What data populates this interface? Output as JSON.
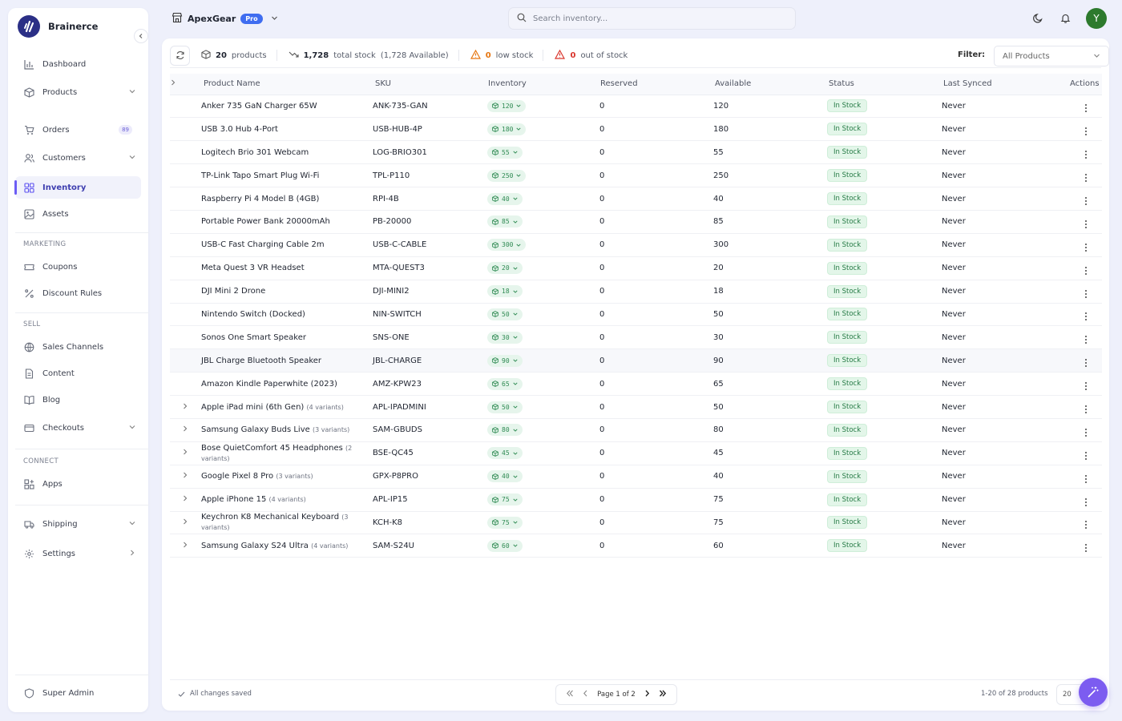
{
  "brand": {
    "name": "Brainerce"
  },
  "sidebar": {
    "items": [
      {
        "label": "Dashboard"
      },
      {
        "label": "Products"
      },
      {
        "label": "Orders",
        "badge": "89"
      },
      {
        "label": "Customers"
      },
      {
        "label": "Inventory",
        "active": true
      },
      {
        "label": "Assets"
      },
      {
        "label": "Coupons"
      },
      {
        "label": "Discount Rules"
      },
      {
        "label": "Sales Channels"
      },
      {
        "label": "Content"
      },
      {
        "label": "Blog"
      },
      {
        "label": "Checkouts"
      },
      {
        "label": "Apps"
      },
      {
        "label": "Shipping"
      },
      {
        "label": "Settings"
      }
    ],
    "sections": {
      "marketing": "MARKETING",
      "sell": "SELL",
      "connect": "CONNECT"
    },
    "footer_label": "Super Admin"
  },
  "topbar": {
    "store_name": "ApexGear",
    "plan_badge": "Pro",
    "search_placeholder": "Search inventory...",
    "avatar_initial": "Y"
  },
  "stats": {
    "products_count": "20",
    "products_label": "products",
    "total_stock": "1,728",
    "total_stock_label": "total stock",
    "available_note": "(1,728 Available)",
    "low_stock_count": "0",
    "low_stock_label": "low stock",
    "out_of_stock_count": "0",
    "out_of_stock_label": "out of stock"
  },
  "filter": {
    "label": "Filter:",
    "value": "All Products"
  },
  "table": {
    "headers": {
      "name": "Product Name",
      "sku": "SKU",
      "inventory": "Inventory",
      "reserved": "Reserved",
      "available": "Available",
      "status": "Status",
      "synced": "Last Synced",
      "actions": "Actions"
    },
    "rows": [
      {
        "name": "Anker 735 GaN Charger 65W",
        "variants": "",
        "sku": "ANK-735-GAN",
        "inventory": "120",
        "reserved": "0",
        "available": "120",
        "status": "In Stock",
        "synced": "Never"
      },
      {
        "name": "USB 3.0 Hub 4-Port",
        "variants": "",
        "sku": "USB-HUB-4P",
        "inventory": "180",
        "reserved": "0",
        "available": "180",
        "status": "In Stock",
        "synced": "Never"
      },
      {
        "name": "Logitech Brio 301 Webcam",
        "variants": "",
        "sku": "LOG-BRIO301",
        "inventory": "55",
        "reserved": "0",
        "available": "55",
        "status": "In Stock",
        "synced": "Never"
      },
      {
        "name": "TP-Link Tapo Smart Plug Wi-Fi",
        "variants": "",
        "sku": "TPL-P110",
        "inventory": "250",
        "reserved": "0",
        "available": "250",
        "status": "In Stock",
        "synced": "Never"
      },
      {
        "name": "Raspberry Pi 4 Model B (4GB)",
        "variants": "",
        "sku": "RPI-4B",
        "inventory": "40",
        "reserved": "0",
        "available": "40",
        "status": "In Stock",
        "synced": "Never"
      },
      {
        "name": "Portable Power Bank 20000mAh",
        "variants": "",
        "sku": "PB-20000",
        "inventory": "85",
        "reserved": "0",
        "available": "85",
        "status": "In Stock",
        "synced": "Never"
      },
      {
        "name": "USB-C Fast Charging Cable 2m",
        "variants": "",
        "sku": "USB-C-CABLE",
        "inventory": "300",
        "reserved": "0",
        "available": "300",
        "status": "In Stock",
        "synced": "Never"
      },
      {
        "name": "Meta Quest 3 VR Headset",
        "variants": "",
        "sku": "MTA-QUEST3",
        "inventory": "20",
        "reserved": "0",
        "available": "20",
        "status": "In Stock",
        "synced": "Never"
      },
      {
        "name": "DJI Mini 2 Drone",
        "variants": "",
        "sku": "DJI-MINI2",
        "inventory": "18",
        "reserved": "0",
        "available": "18",
        "status": "In Stock",
        "synced": "Never"
      },
      {
        "name": "Nintendo Switch (Docked)",
        "variants": "",
        "sku": "NIN-SWITCH",
        "inventory": "50",
        "reserved": "0",
        "available": "50",
        "status": "In Stock",
        "synced": "Never"
      },
      {
        "name": "Sonos One Smart Speaker",
        "variants": "",
        "sku": "SNS-ONE",
        "inventory": "30",
        "reserved": "0",
        "available": "30",
        "status": "In Stock",
        "synced": "Never"
      },
      {
        "name": "JBL Charge Bluetooth Speaker",
        "variants": "",
        "sku": "JBL-CHARGE",
        "inventory": "90",
        "reserved": "0",
        "available": "90",
        "status": "In Stock",
        "synced": "Never"
      },
      {
        "name": "Amazon Kindle Paperwhite (2023)",
        "variants": "",
        "sku": "AMZ-KPW23",
        "inventory": "65",
        "reserved": "0",
        "available": "65",
        "status": "In Stock",
        "synced": "Never"
      },
      {
        "name": "Apple iPad mini (6th Gen)",
        "variants": "(4 variants)",
        "sku": "APL-IPADMINI",
        "inventory": "50",
        "reserved": "0",
        "available": "50",
        "status": "In Stock",
        "synced": "Never"
      },
      {
        "name": "Samsung Galaxy Buds Live",
        "variants": "(3 variants)",
        "sku": "SAM-GBUDS",
        "inventory": "80",
        "reserved": "0",
        "available": "80",
        "status": "In Stock",
        "synced": "Never"
      },
      {
        "name": "Bose QuietComfort 45 Headphones",
        "variants": "(2 variants)",
        "sku": "BSE-QC45",
        "inventory": "45",
        "reserved": "0",
        "available": "45",
        "status": "In Stock",
        "synced": "Never"
      },
      {
        "name": "Google Pixel 8 Pro",
        "variants": "(3 variants)",
        "sku": "GPX-P8PRO",
        "inventory": "40",
        "reserved": "0",
        "available": "40",
        "status": "In Stock",
        "synced": "Never"
      },
      {
        "name": "Apple iPhone 15",
        "variants": "(4 variants)",
        "sku": "APL-IP15",
        "inventory": "75",
        "reserved": "0",
        "available": "75",
        "status": "In Stock",
        "synced": "Never"
      },
      {
        "name": "Keychron K8 Mechanical Keyboard",
        "variants": "(3 variants)",
        "sku": "KCH-K8",
        "inventory": "75",
        "reserved": "0",
        "available": "75",
        "status": "In Stock",
        "synced": "Never"
      },
      {
        "name": "Samsung Galaxy S24 Ultra",
        "variants": "(4 variants)",
        "sku": "SAM-S24U",
        "inventory": "60",
        "reserved": "0",
        "available": "60",
        "status": "In Stock",
        "synced": "Never"
      }
    ]
  },
  "footer": {
    "saved_text": "All changes saved",
    "page_text": "Page 1 of 2",
    "range_text": "1-20 of 28 products",
    "page_size": "20"
  },
  "colors": {
    "accent": "#6b5cf5",
    "brand": "#2b2f86",
    "in_stock": "#257a45",
    "warning": "#e6750f",
    "danger": "#d9342b"
  }
}
